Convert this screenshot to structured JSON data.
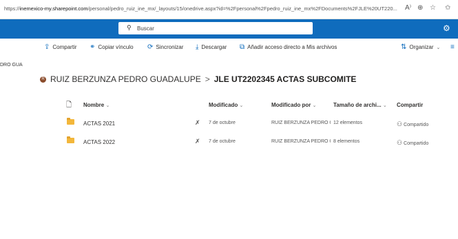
{
  "browser": {
    "url_prefix": "https://",
    "url_host": "inemexico-my.sharepoint.com",
    "url_rest": "/personal/pedro_ruiz_ine_mx/_layouts/15/onedrive.aspx?id=%2Fpersonal%2Fpedro_ruiz_ine_mx%2FDocuments%2FJLE%20UT220..."
  },
  "suite": {
    "search_label": "Buscar"
  },
  "commands": [
    {
      "label": "Compartir",
      "icon": "share-icon",
      "glyph": "⇪"
    },
    {
      "label": "Copiar vínculo",
      "icon": "link-icon",
      "glyph": "⚭"
    },
    {
      "label": "Sincronizar",
      "icon": "sync-icon",
      "glyph": "⟳"
    },
    {
      "label": "Descargar",
      "icon": "download-icon",
      "glyph": "⤓"
    },
    {
      "label": "Añadir acceso directo a Mis archivos",
      "icon": "shortcut-icon",
      "glyph": "⧉"
    }
  ],
  "organize": {
    "label": "Organizar"
  },
  "side_text": "DRO GUA",
  "breadcrumb": {
    "initial": "R",
    "user": "RUIZ BERZUNZA PEDRO GUADALUPE",
    "separator": ">",
    "current": "JLE UT2202345 ACTAS SUBCOMITE"
  },
  "columns": {
    "name": "Nombre",
    "modified": "Modificado",
    "modified_by": "Modificado por",
    "size": "Tamaño de archi...",
    "share": "Compartir"
  },
  "rows": [
    {
      "name": "ACTAS 2021",
      "modified": "7 de octubre",
      "modified_by": "RUIZ BERZUNZA PEDRO G",
      "size": "12 elementos",
      "share": "Compartido"
    },
    {
      "name": "ACTAS 2022",
      "modified": "7 de octubre",
      "modified_by": "RUIZ BERZUNZA PEDRO G",
      "size": "8 elementos",
      "share": "Compartido"
    }
  ],
  "colors": {
    "suite_bar": "#0f6cbd",
    "folder": "#f3b73b"
  }
}
